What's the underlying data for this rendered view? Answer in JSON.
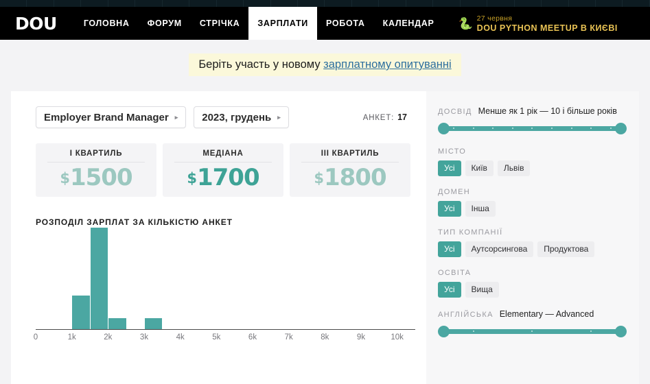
{
  "nav": {
    "logo": "DOU",
    "items": [
      {
        "label": "ГОЛОВНА",
        "active": false
      },
      {
        "label": "ФОРУМ",
        "active": false
      },
      {
        "label": "СТРІЧКА",
        "active": false
      },
      {
        "label": "ЗАРПЛАТИ",
        "active": true
      },
      {
        "label": "РОБОТА",
        "active": false
      },
      {
        "label": "КАЛЕНДАР",
        "active": false
      }
    ],
    "promo": {
      "icon": "snake-icon",
      "date": "27 червня",
      "title": "DOU PYTHON MEETUP В КИЄВІ"
    }
  },
  "banner": {
    "text": "Беріть участь у новому ",
    "link": "зарплатному опитуванні"
  },
  "filters": {
    "position": "Employer Brand Manager",
    "period": "2023, грудень",
    "caret": "▸",
    "count_label": "АНКЕТ:",
    "count_value": "17"
  },
  "cards": [
    {
      "title": "I КВАРТИЛЬ",
      "currency": "$",
      "value": "1500",
      "accent": "#9cc8c0"
    },
    {
      "title": "МЕДІАНА",
      "currency": "$",
      "value": "1700",
      "accent": "#3ea396"
    },
    {
      "title": "III КВАРТИЛЬ",
      "currency": "$",
      "value": "1800",
      "accent": "#9cc8c0"
    }
  ],
  "chart_data": {
    "type": "bar",
    "title": "РОЗПОДІЛ ЗАРПЛАТ ЗА КІЛЬКІСТЮ АНКЕТ",
    "xlabel": "",
    "ylabel": "",
    "grid": false,
    "legend": null,
    "bar_color": "#4ba7a2",
    "xlim": [
      0,
      10500
    ],
    "tick_labels": [
      "0",
      "1k",
      "2k",
      "3k",
      "4k",
      "5k",
      "6k",
      "7k",
      "8k",
      "9k",
      "10k"
    ],
    "tick_values": [
      0,
      1000,
      2000,
      3000,
      4000,
      5000,
      6000,
      7000,
      8000,
      9000,
      10000
    ],
    "bin_width": 500,
    "bins": [
      {
        "x0": 1000,
        "x1": 1500,
        "count": 3
      },
      {
        "x0": 1500,
        "x1": 2000,
        "count": 9
      },
      {
        "x0": 2000,
        "x1": 2500,
        "count": 1
      },
      {
        "x0": 3000,
        "x1": 3500,
        "count": 1
      }
    ],
    "values": [
      3,
      9,
      1,
      1
    ],
    "categories": [
      "1000–1500",
      "1500–2000",
      "2000–2500",
      "3000–3500"
    ],
    "ylim": [
      0,
      9
    ]
  },
  "sidebar": {
    "experience": {
      "label": "ДОСВІД",
      "range": "Менше як 1 рік — 10 і більше років",
      "ticks": 9
    },
    "city": {
      "label": "МІСТО",
      "chips": [
        {
          "label": "Усі",
          "active": true
        },
        {
          "label": "Київ",
          "active": false
        },
        {
          "label": "Львів",
          "active": false
        }
      ]
    },
    "domain": {
      "label": "ДОМЕН",
      "chips": [
        {
          "label": "Усі",
          "active": true
        },
        {
          "label": "Інша",
          "active": false
        }
      ]
    },
    "company_type": {
      "label": "ТИП КОМПАНІЇ",
      "chips": [
        {
          "label": "Усі",
          "active": true
        },
        {
          "label": "Аутсорсингова",
          "active": false
        },
        {
          "label": "Продуктова",
          "active": false
        }
      ]
    },
    "education": {
      "label": "ОСВІТА",
      "chips": [
        {
          "label": "Усі",
          "active": true
        },
        {
          "label": "Вища",
          "active": false
        }
      ]
    },
    "english": {
      "label": "АНГЛІЙСЬКА",
      "range": "Elementary — Advanced",
      "ticks": 3
    }
  }
}
